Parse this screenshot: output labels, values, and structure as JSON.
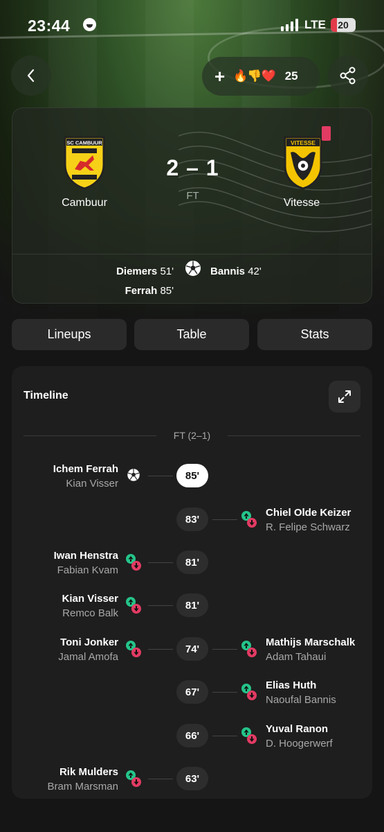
{
  "status_bar": {
    "time": "23:44",
    "network": "LTE",
    "battery": "20"
  },
  "header": {
    "reaction_count": "25",
    "reaction_emojis": "🔥👎❤️"
  },
  "match": {
    "home": {
      "name": "Cambuur",
      "crest_text": "SC CAMBUUR"
    },
    "away": {
      "name": "Vitesse",
      "crest_text": "VITESSE",
      "red_cards": 1
    },
    "score": "2 – 1",
    "status": "FT",
    "scorers_home": [
      {
        "name": "Diemers",
        "minute": "51'"
      },
      {
        "name": "Ferrah",
        "minute": "85'"
      }
    ],
    "scorers_away": [
      {
        "name": "Bannis",
        "minute": "42'"
      }
    ]
  },
  "tabs": {
    "lineups": "Lineups",
    "table": "Table",
    "stats": "Stats"
  },
  "timeline": {
    "title": "Timeline",
    "ft_label": "FT (2–1)",
    "events": [
      {
        "minute": "85'",
        "type": "goal",
        "home": {
          "main": "Ichem Ferrah",
          "sub": "Kian Visser"
        }
      },
      {
        "minute": "83'",
        "type": "sub",
        "away": {
          "main": "Chiel Olde Keizer",
          "sub": "R. Felipe Schwarz"
        }
      },
      {
        "minute": "81'",
        "type": "sub",
        "home": {
          "main": "Iwan Henstra",
          "sub": "Fabian Kvam"
        }
      },
      {
        "minute": "81'",
        "type": "sub",
        "home": {
          "main": "Kian Visser",
          "sub": "Remco Balk"
        }
      },
      {
        "minute": "74'",
        "type": "sub",
        "home": {
          "main": "Toni Jonker",
          "sub": "Jamal Amofa"
        },
        "away": {
          "main": "Mathijs Marschalk",
          "sub": "Adam Tahaui"
        }
      },
      {
        "minute": "67'",
        "type": "sub",
        "away": {
          "main": "Elias Huth",
          "sub": "Naoufal Bannis"
        }
      },
      {
        "minute": "66'",
        "type": "sub",
        "away": {
          "main": "Yuval Ranon",
          "sub": "D. Hoogerwerf"
        }
      },
      {
        "minute": "63'",
        "type": "sub",
        "home": {
          "main": "Rik Mulders",
          "sub": "Bram Marsman"
        }
      }
    ]
  },
  "colors": {
    "sub_in": "#25c48a",
    "sub_out": "#e23b63",
    "red_card": "#e23b63",
    "cambuur_yellow": "#f7d117",
    "vitesse_yellow": "#f5c400"
  }
}
